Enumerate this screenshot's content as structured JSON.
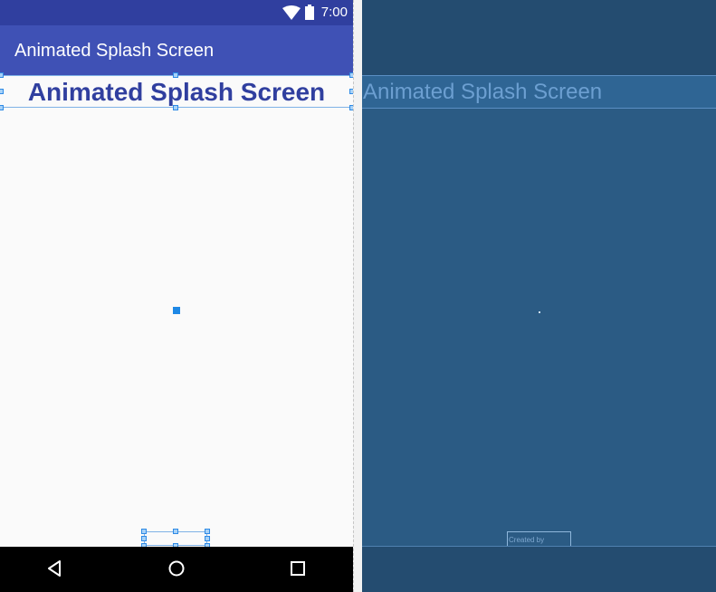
{
  "status_bar": {
    "time": "7:00"
  },
  "app_bar": {
    "title": "Animated Splash Screen"
  },
  "content": {
    "headline": "Animated Splash Screen"
  },
  "blueprint": {
    "headline": "Animated Splash Screen",
    "created_by": "Created by"
  },
  "icons": {
    "wifi": "wifi-icon",
    "battery": "battery-icon",
    "back": "back-triangle-icon",
    "home": "home-circle-icon",
    "recents": "recents-square-icon"
  },
  "colors": {
    "status_bar": "#303f9f",
    "app_bar": "#3f51b5",
    "headline": "#303f9f",
    "blueprint_bg": "#2b5b84",
    "selection": "#2e8ae6"
  }
}
